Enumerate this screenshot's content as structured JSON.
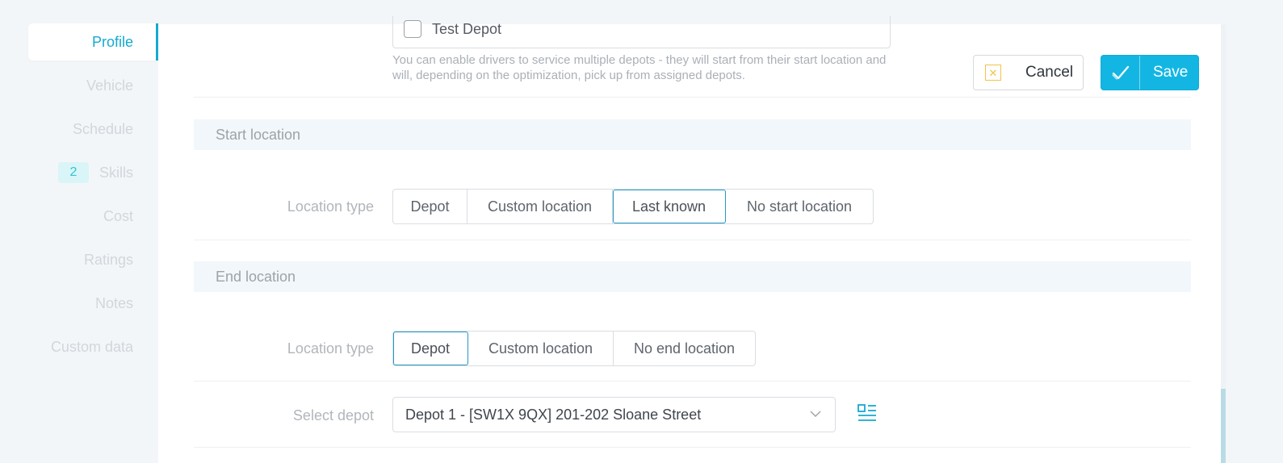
{
  "sidebar": {
    "items": [
      {
        "label": "Profile",
        "active": true
      },
      {
        "label": "Vehicle"
      },
      {
        "label": "Schedule"
      },
      {
        "label": "Skills",
        "badge": "2"
      },
      {
        "label": "Cost"
      },
      {
        "label": "Ratings"
      },
      {
        "label": "Notes"
      },
      {
        "label": "Custom data"
      }
    ]
  },
  "depots": {
    "checkbox_label": "Test Depot",
    "checked": false,
    "helper": "You can enable drivers to service multiple depots - they will start from their start location and will, depending on the optimization, pick up from assigned depots."
  },
  "actions": {
    "cancel_label": "Cancel",
    "save_label": "Save"
  },
  "start_location": {
    "header": "Start location",
    "field_label": "Location type",
    "options": [
      "Depot",
      "Custom location",
      "Last known",
      "No start location"
    ],
    "selected": "Last known"
  },
  "end_location": {
    "header": "End location",
    "field_label": "Location type",
    "options": [
      "Depot",
      "Custom location",
      "No end location"
    ],
    "selected": "Depot",
    "select_depot_label": "Select depot",
    "select_depot_value": "Depot 1 - [SW1X 9QX] 201-202 Sloane Street"
  },
  "colors": {
    "accent": "#14aad1",
    "save_button": "#13b6e3",
    "cancel_icon": "#f2c34a",
    "badge_bg": "#d9f5f8",
    "section_header_bg": "#f2f7fb"
  },
  "icons": {
    "cancel": "x-square-icon",
    "save": "checkmark-icon",
    "select": "chevron-down-icon",
    "details": "list-details-icon"
  }
}
